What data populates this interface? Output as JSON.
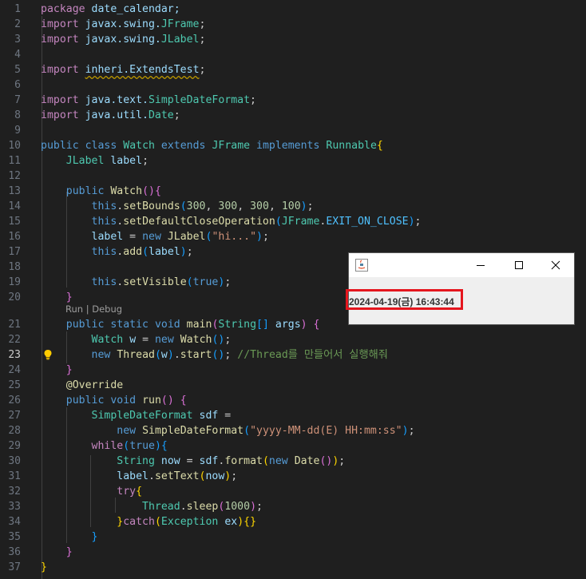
{
  "editor": {
    "active_line": 23,
    "codelens": {
      "run": "Run",
      "separator": " | ",
      "debug": "Debug"
    },
    "lines": [
      {
        "n": "1",
        "tokens": [
          {
            "t": "package",
            "c": "kw"
          },
          {
            "t": " date_calendar;",
            "c": "var"
          }
        ]
      },
      {
        "n": "2",
        "tokens": [
          {
            "t": "import",
            "c": "kw"
          },
          {
            "t": " javax.swing.",
            "c": "var"
          },
          {
            "t": "JFrame",
            "c": "ty"
          },
          {
            "t": ";",
            "c": ""
          }
        ]
      },
      {
        "n": "3",
        "tokens": [
          {
            "t": "import",
            "c": "kw"
          },
          {
            "t": " javax.swing.",
            "c": "var"
          },
          {
            "t": "JLabel",
            "c": "ty"
          },
          {
            "t": ";",
            "c": ""
          }
        ]
      },
      {
        "n": "4",
        "tokens": []
      },
      {
        "n": "5",
        "tokens": [
          {
            "t": "import",
            "c": "kw"
          },
          {
            "t": " ",
            "c": ""
          },
          {
            "t": "inheri.ExtendsTest",
            "c": "var squig"
          },
          {
            "t": ";",
            "c": ""
          }
        ]
      },
      {
        "n": "6",
        "tokens": []
      },
      {
        "n": "7",
        "tokens": [
          {
            "t": "import",
            "c": "kw"
          },
          {
            "t": " java.text.",
            "c": "var"
          },
          {
            "t": "SimpleDateFormat",
            "c": "ty"
          },
          {
            "t": ";",
            "c": ""
          }
        ]
      },
      {
        "n": "8",
        "tokens": [
          {
            "t": "import",
            "c": "kw"
          },
          {
            "t": " java.util.",
            "c": "var"
          },
          {
            "t": "Date",
            "c": "ty"
          },
          {
            "t": ";",
            "c": ""
          }
        ]
      },
      {
        "n": "9",
        "tokens": []
      },
      {
        "n": "10",
        "tokens": [
          {
            "t": "public",
            "c": "kwb"
          },
          {
            "t": " ",
            "c": ""
          },
          {
            "t": "class",
            "c": "kwb"
          },
          {
            "t": " ",
            "c": ""
          },
          {
            "t": "Watch",
            "c": "ty"
          },
          {
            "t": " ",
            "c": ""
          },
          {
            "t": "extends",
            "c": "kwb"
          },
          {
            "t": " ",
            "c": ""
          },
          {
            "t": "JFrame",
            "c": "ty"
          },
          {
            "t": " ",
            "c": ""
          },
          {
            "t": "implements",
            "c": "kwb"
          },
          {
            "t": " ",
            "c": ""
          },
          {
            "t": "Runnable",
            "c": "ty"
          },
          {
            "t": "{",
            "c": "b1"
          }
        ]
      },
      {
        "n": "11",
        "tokens": [
          {
            "t": "    ",
            "c": ""
          },
          {
            "t": "JLabel",
            "c": "ty"
          },
          {
            "t": " ",
            "c": ""
          },
          {
            "t": "label",
            "c": "var"
          },
          {
            "t": ";",
            "c": ""
          }
        ]
      },
      {
        "n": "12",
        "tokens": []
      },
      {
        "n": "13",
        "tokens": [
          {
            "t": "    ",
            "c": ""
          },
          {
            "t": "public",
            "c": "kwb"
          },
          {
            "t": " ",
            "c": ""
          },
          {
            "t": "Watch",
            "c": "fn"
          },
          {
            "t": "()",
            "c": "b2"
          },
          {
            "t": "{",
            "c": "b2"
          }
        ]
      },
      {
        "n": "14",
        "tokens": [
          {
            "t": "        ",
            "c": ""
          },
          {
            "t": "this",
            "c": "kwb"
          },
          {
            "t": ".",
            "c": ""
          },
          {
            "t": "setBounds",
            "c": "fn"
          },
          {
            "t": "(",
            "c": "b3"
          },
          {
            "t": "300",
            "c": "num"
          },
          {
            "t": ", ",
            "c": ""
          },
          {
            "t": "300",
            "c": "num"
          },
          {
            "t": ", ",
            "c": ""
          },
          {
            "t": "300",
            "c": "num"
          },
          {
            "t": ", ",
            "c": ""
          },
          {
            "t": "100",
            "c": "num"
          },
          {
            "t": ")",
            "c": "b3"
          },
          {
            "t": ";",
            "c": ""
          }
        ]
      },
      {
        "n": "15",
        "tokens": [
          {
            "t": "        ",
            "c": ""
          },
          {
            "t": "this",
            "c": "kwb"
          },
          {
            "t": ".",
            "c": ""
          },
          {
            "t": "setDefaultCloseOperation",
            "c": "fn"
          },
          {
            "t": "(",
            "c": "b3"
          },
          {
            "t": "JFrame",
            "c": "ty"
          },
          {
            "t": ".",
            "c": ""
          },
          {
            "t": "EXIT_ON_CLOSE",
            "c": "cst"
          },
          {
            "t": ")",
            "c": "b3"
          },
          {
            "t": ";",
            "c": ""
          }
        ]
      },
      {
        "n": "16",
        "tokens": [
          {
            "t": "        ",
            "c": ""
          },
          {
            "t": "label",
            "c": "var"
          },
          {
            "t": " = ",
            "c": ""
          },
          {
            "t": "new",
            "c": "kwb"
          },
          {
            "t": " ",
            "c": ""
          },
          {
            "t": "JLabel",
            "c": "fn"
          },
          {
            "t": "(",
            "c": "b3"
          },
          {
            "t": "\"hi...\"",
            "c": "str"
          },
          {
            "t": ")",
            "c": "b3"
          },
          {
            "t": ";",
            "c": ""
          }
        ]
      },
      {
        "n": "17",
        "tokens": [
          {
            "t": "        ",
            "c": ""
          },
          {
            "t": "this",
            "c": "kwb"
          },
          {
            "t": ".",
            "c": ""
          },
          {
            "t": "add",
            "c": "fn"
          },
          {
            "t": "(",
            "c": "b3"
          },
          {
            "t": "label",
            "c": "var"
          },
          {
            "t": ")",
            "c": "b3"
          },
          {
            "t": ";",
            "c": ""
          }
        ]
      },
      {
        "n": "18",
        "tokens": []
      },
      {
        "n": "19",
        "tokens": [
          {
            "t": "        ",
            "c": ""
          },
          {
            "t": "this",
            "c": "kwb"
          },
          {
            "t": ".",
            "c": ""
          },
          {
            "t": "setVisible",
            "c": "fn"
          },
          {
            "t": "(",
            "c": "b3"
          },
          {
            "t": "true",
            "c": "kwb"
          },
          {
            "t": ")",
            "c": "b3"
          },
          {
            "t": ";",
            "c": ""
          }
        ]
      },
      {
        "n": "20",
        "tokens": [
          {
            "t": "    ",
            "c": ""
          },
          {
            "t": "}",
            "c": "b2"
          }
        ]
      },
      {
        "n": "21",
        "tokens": [
          {
            "t": "    ",
            "c": ""
          },
          {
            "t": "public",
            "c": "kwb"
          },
          {
            "t": " ",
            "c": ""
          },
          {
            "t": "static",
            "c": "kwb"
          },
          {
            "t": " ",
            "c": ""
          },
          {
            "t": "void",
            "c": "kwb"
          },
          {
            "t": " ",
            "c": ""
          },
          {
            "t": "main",
            "c": "fn"
          },
          {
            "t": "(",
            "c": "b2"
          },
          {
            "t": "String",
            "c": "ty"
          },
          {
            "t": "[]",
            "c": "b3"
          },
          {
            "t": " ",
            "c": ""
          },
          {
            "t": "args",
            "c": "var"
          },
          {
            "t": ")",
            "c": "b2"
          },
          {
            "t": " ",
            "c": ""
          },
          {
            "t": "{",
            "c": "b2"
          }
        ]
      },
      {
        "n": "22",
        "tokens": [
          {
            "t": "        ",
            "c": ""
          },
          {
            "t": "Watch",
            "c": "ty"
          },
          {
            "t": " ",
            "c": ""
          },
          {
            "t": "w",
            "c": "var"
          },
          {
            "t": " = ",
            "c": ""
          },
          {
            "t": "new",
            "c": "kwb"
          },
          {
            "t": " ",
            "c": ""
          },
          {
            "t": "Watch",
            "c": "fn"
          },
          {
            "t": "()",
            "c": "b3"
          },
          {
            "t": ";",
            "c": ""
          }
        ]
      },
      {
        "n": "23",
        "tokens": [
          {
            "t": "        ",
            "c": ""
          },
          {
            "t": "new",
            "c": "kwb"
          },
          {
            "t": " ",
            "c": ""
          },
          {
            "t": "Thread",
            "c": "fn"
          },
          {
            "t": "(",
            "c": "b3"
          },
          {
            "t": "w",
            "c": "var"
          },
          {
            "t": ")",
            "c": "b3"
          },
          {
            "t": ".",
            "c": ""
          },
          {
            "t": "start",
            "c": "fn"
          },
          {
            "t": "()",
            "c": "b3"
          },
          {
            "t": "; ",
            "c": ""
          },
          {
            "t": "//Thread를 만들어서 실행해줘",
            "c": "cm"
          }
        ]
      },
      {
        "n": "24",
        "tokens": [
          {
            "t": "    ",
            "c": ""
          },
          {
            "t": "}",
            "c": "b2"
          }
        ]
      },
      {
        "n": "25",
        "tokens": [
          {
            "t": "    ",
            "c": ""
          },
          {
            "t": "@Override",
            "c": "deco"
          }
        ]
      },
      {
        "n": "26",
        "tokens": [
          {
            "t": "    ",
            "c": ""
          },
          {
            "t": "public",
            "c": "kwb"
          },
          {
            "t": " ",
            "c": ""
          },
          {
            "t": "void",
            "c": "kwb"
          },
          {
            "t": " ",
            "c": ""
          },
          {
            "t": "run",
            "c": "fn"
          },
          {
            "t": "()",
            "c": "b2"
          },
          {
            "t": " ",
            "c": ""
          },
          {
            "t": "{",
            "c": "b2"
          }
        ]
      },
      {
        "n": "27",
        "tokens": [
          {
            "t": "        ",
            "c": ""
          },
          {
            "t": "SimpleDateFormat",
            "c": "ty"
          },
          {
            "t": " ",
            "c": ""
          },
          {
            "t": "sdf",
            "c": "var"
          },
          {
            "t": " =",
            "c": ""
          }
        ]
      },
      {
        "n": "28",
        "tokens": [
          {
            "t": "            ",
            "c": ""
          },
          {
            "t": "new",
            "c": "kwb"
          },
          {
            "t": " ",
            "c": ""
          },
          {
            "t": "SimpleDateFormat",
            "c": "fn"
          },
          {
            "t": "(",
            "c": "b3"
          },
          {
            "t": "\"yyyy-MM-dd(E) HH:mm:ss\"",
            "c": "str"
          },
          {
            "t": ")",
            "c": "b3"
          },
          {
            "t": ";",
            "c": ""
          }
        ]
      },
      {
        "n": "29",
        "tokens": [
          {
            "t": "        ",
            "c": ""
          },
          {
            "t": "while",
            "c": "kw"
          },
          {
            "t": "(",
            "c": "b3"
          },
          {
            "t": "true",
            "c": "kwb"
          },
          {
            "t": ")",
            "c": "b3"
          },
          {
            "t": "{",
            "c": "b3"
          }
        ]
      },
      {
        "n": "30",
        "tokens": [
          {
            "t": "            ",
            "c": ""
          },
          {
            "t": "String",
            "c": "ty"
          },
          {
            "t": " ",
            "c": ""
          },
          {
            "t": "now",
            "c": "var"
          },
          {
            "t": " = ",
            "c": ""
          },
          {
            "t": "sdf",
            "c": "var"
          },
          {
            "t": ".",
            "c": ""
          },
          {
            "t": "format",
            "c": "fn"
          },
          {
            "t": "(",
            "c": "b1"
          },
          {
            "t": "new",
            "c": "kwb"
          },
          {
            "t": " ",
            "c": ""
          },
          {
            "t": "Date",
            "c": "fn"
          },
          {
            "t": "()",
            "c": "b2"
          },
          {
            "t": ")",
            "c": "b1"
          },
          {
            "t": ";",
            "c": ""
          }
        ]
      },
      {
        "n": "31",
        "tokens": [
          {
            "t": "            ",
            "c": ""
          },
          {
            "t": "label",
            "c": "var"
          },
          {
            "t": ".",
            "c": ""
          },
          {
            "t": "setText",
            "c": "fn"
          },
          {
            "t": "(",
            "c": "b1"
          },
          {
            "t": "now",
            "c": "var"
          },
          {
            "t": ")",
            "c": "b1"
          },
          {
            "t": ";",
            "c": ""
          }
        ]
      },
      {
        "n": "32",
        "tokens": [
          {
            "t": "            ",
            "c": ""
          },
          {
            "t": "try",
            "c": "kw"
          },
          {
            "t": "{",
            "c": "b1"
          }
        ]
      },
      {
        "n": "33",
        "tokens": [
          {
            "t": "                ",
            "c": ""
          },
          {
            "t": "Thread",
            "c": "ty"
          },
          {
            "t": ".",
            "c": ""
          },
          {
            "t": "sleep",
            "c": "fn"
          },
          {
            "t": "(",
            "c": "b2"
          },
          {
            "t": "1000",
            "c": "num"
          },
          {
            "t": ")",
            "c": "b2"
          },
          {
            "t": ";",
            "c": ""
          }
        ]
      },
      {
        "n": "34",
        "tokens": [
          {
            "t": "            ",
            "c": ""
          },
          {
            "t": "}",
            "c": "b1"
          },
          {
            "t": "catch",
            "c": "kw"
          },
          {
            "t": "(",
            "c": "b1"
          },
          {
            "t": "Exception",
            "c": "ty"
          },
          {
            "t": " ",
            "c": ""
          },
          {
            "t": "ex",
            "c": "var"
          },
          {
            "t": ")",
            "c": "b1"
          },
          {
            "t": "{}",
            "c": "b1"
          }
        ]
      },
      {
        "n": "35",
        "tokens": [
          {
            "t": "        ",
            "c": ""
          },
          {
            "t": "}",
            "c": "b3"
          }
        ]
      },
      {
        "n": "36",
        "tokens": [
          {
            "t": "    ",
            "c": ""
          },
          {
            "t": "}",
            "c": "b2"
          }
        ]
      },
      {
        "n": "37",
        "tokens": [
          {
            "t": "}",
            "c": "b1"
          }
        ]
      }
    ]
  },
  "swing_window": {
    "label_text": "2024-04-19(금) 16:43:44",
    "icons": {
      "app": "java-icon",
      "minimize": "minimize-icon",
      "maximize": "maximize-icon",
      "close": "close-icon"
    }
  },
  "colors": {
    "background": "#1f1f1f",
    "highlight_border": "#e5161e"
  }
}
